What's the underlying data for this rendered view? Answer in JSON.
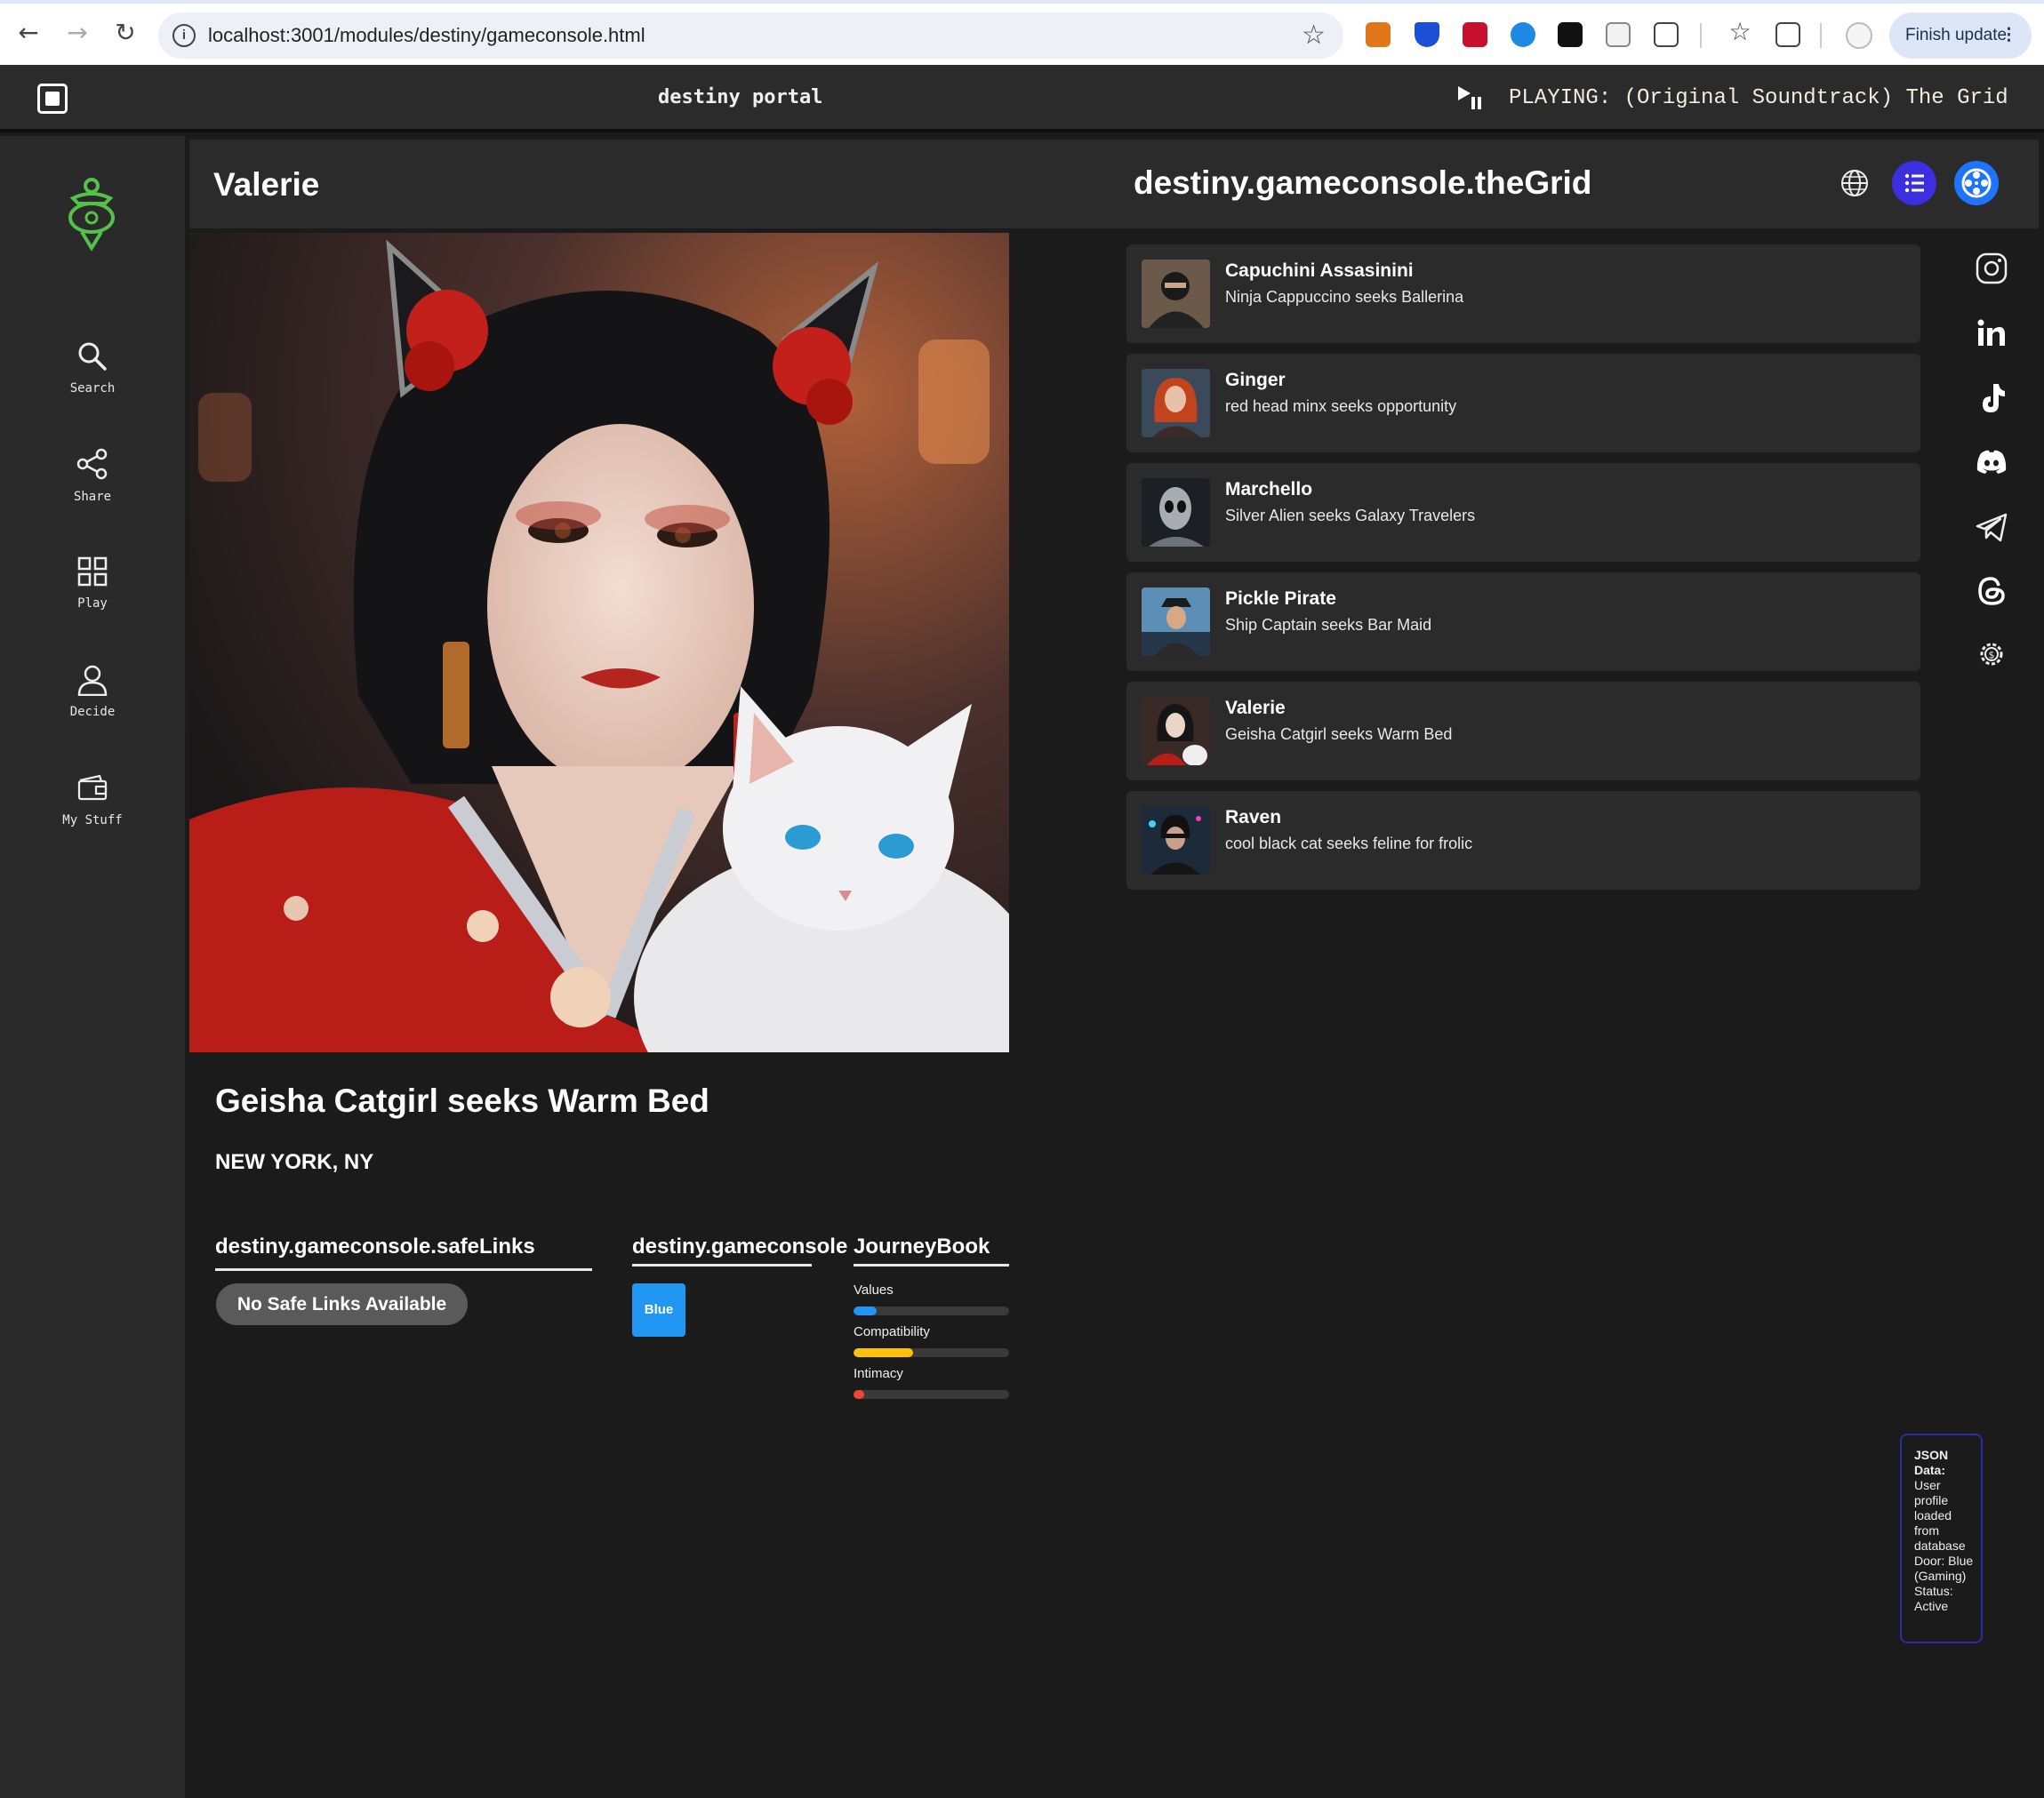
{
  "browser": {
    "url": "localhost:3001/modules/destiny/gameconsole.html",
    "finish_update": "Finish update"
  },
  "topbar": {
    "title": "destiny portal",
    "now_playing": "PLAYING: (Original Soundtrack) The Grid"
  },
  "sidebar": {
    "items": [
      {
        "label": "Search",
        "icon": "search-icon"
      },
      {
        "label": "Share",
        "icon": "share-icon"
      },
      {
        "label": "Play",
        "icon": "grid-icon"
      },
      {
        "label": "Decide",
        "icon": "person-icon"
      },
      {
        "label": "My Stuff",
        "icon": "wallet-icon"
      }
    ]
  },
  "profile": {
    "name": "Valerie",
    "headline": "Geisha Catgirl seeks Warm Bed",
    "location": "NEW YORK, NY",
    "safe_links_title": "destiny.gameconsole.safeLinks",
    "safe_links_empty": "No Safe Links Available",
    "journey_title": "destiny.gameconsole JourneyBook",
    "door": "Blue",
    "meters": [
      {
        "label": "Values",
        "value": 0.15,
        "color": "#2196f3"
      },
      {
        "label": "Compatibility",
        "value": 0.38,
        "color": "#ffc107"
      },
      {
        "label": "Intimacy",
        "value": 0.07,
        "color": "#f44336"
      }
    ]
  },
  "grid": {
    "title": "destiny.gameconsole.theGrid",
    "items": [
      {
        "name": "Capuchini Assasinini",
        "tagline": "Ninja Cappuccino seeks Ballerina"
      },
      {
        "name": "Ginger",
        "tagline": "red head minx seeks opportunity"
      },
      {
        "name": "Marchello",
        "tagline": "Silver Alien seeks Galaxy Travelers"
      },
      {
        "name": "Pickle Pirate",
        "tagline": "Ship Captain seeks Bar Maid"
      },
      {
        "name": "Valerie",
        "tagline": "Geisha Catgirl seeks Warm Bed"
      },
      {
        "name": "Raven",
        "tagline": "cool black cat seeks feline for frolic"
      }
    ]
  },
  "social": [
    "instagram-icon",
    "linkedin-icon",
    "tiktok-icon",
    "discord-icon",
    "telegram-icon",
    "threads-icon",
    "settings-icon"
  ],
  "json_panel": {
    "heading": "JSON Data:",
    "body": "User profile loaded from database Door: Blue (Gaming) Status: Active"
  }
}
